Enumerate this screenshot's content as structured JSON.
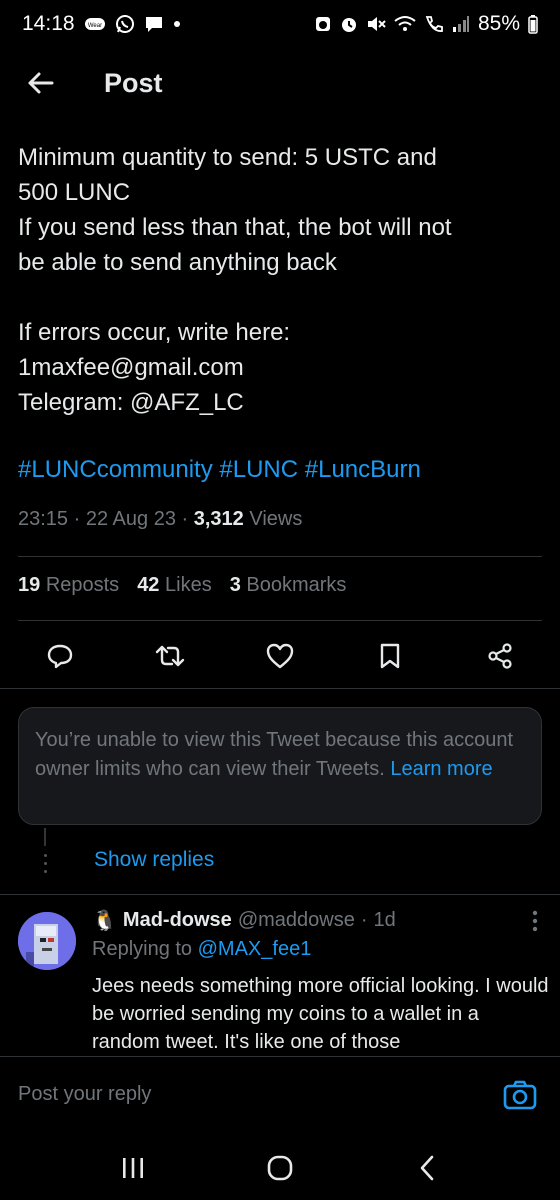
{
  "status_bar": {
    "time": "14:18",
    "battery": "85%",
    "left_icons": [
      "wear-icon",
      "whatsapp-icon",
      "message-icon",
      "dot-icon"
    ],
    "right_icons": [
      "alarm-icon",
      "mute-icon",
      "wifi-icon",
      "call-icon",
      "signal-icon",
      "battery-icon"
    ]
  },
  "header": {
    "title": "Post"
  },
  "tweet": {
    "line1": "Minimum quantity to send: 5 USTC and\n500 LUNC",
    "line2": "If you send less than that, the bot will not\nbe able to send anything back",
    "line3": "If errors occur, write here:\n1maxfee@gmail.com\nTelegram: @AFZ_LC",
    "hashtags": [
      "#LUNCcommunity",
      "#LUNC",
      "#LuncBurn"
    ],
    "time": "23:15",
    "date": "22 Aug 23",
    "views_count": "3,312",
    "views_label": "Views",
    "sep": "·"
  },
  "stats": {
    "reposts_count": "19",
    "reposts_label": "Reposts",
    "likes_count": "42",
    "likes_label": "Likes",
    "bookmarks_count": "3",
    "bookmarks_label": "Bookmarks"
  },
  "actions": [
    "reply-icon",
    "repost-icon",
    "like-icon",
    "bookmark-icon",
    "share-icon"
  ],
  "restricted": {
    "text": "You’re unable to view this Tweet because this account owner limits who can view their Tweets.",
    "link": "Learn more"
  },
  "show_replies": "Show replies",
  "reply": {
    "emoji": "🐧",
    "name": "Mad-dowse",
    "handle": "@maddowse",
    "sep": "·",
    "age": "1d",
    "replying_prefix": "Replying to",
    "replying_handle": "@MAX_fee1",
    "text": "Jees needs something more official looking.  I would be worried sending my coins to a wallet in a random tweet. It's like one of those"
  },
  "composer": {
    "placeholder": "Post your reply"
  },
  "colors": {
    "accent": "#1d9bf0",
    "muted": "#71767b",
    "text": "#e7e9ea",
    "background": "#000000"
  }
}
